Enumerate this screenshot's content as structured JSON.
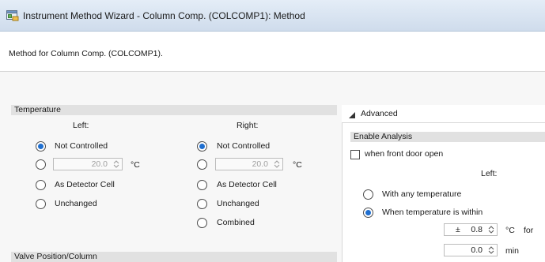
{
  "window": {
    "title": "Instrument Method Wizard - Column Comp. (COLCOMP1): Method",
    "icon": "wizard-icon"
  },
  "header": {
    "text": "Method for Column Comp. (COLCOMP1)."
  },
  "temperature": {
    "section_title": "Temperature",
    "left": {
      "label": "Left:",
      "not_controlled": "Not Controlled",
      "value": "20.0",
      "unit": "°C",
      "as_detector_cell": "As Detector Cell",
      "unchanged": "Unchanged",
      "selected": "Not Controlled"
    },
    "right": {
      "label": "Right:",
      "not_controlled": "Not Controlled",
      "value": "20.0",
      "unit": "°C",
      "as_detector_cell": "As Detector Cell",
      "unchanged": "Unchanged",
      "combined": "Combined",
      "selected": "Not Controlled"
    }
  },
  "valve": {
    "section_title": "Valve Position/Column"
  },
  "advanced": {
    "title": "Advanced",
    "enable_analysis": {
      "section_title": "Enable Analysis",
      "front_door_label": "when front door open",
      "front_door_checked": false,
      "left_label": "Left:",
      "with_any_temperature": "With any temperature",
      "when_within": "When temperature is within",
      "selected": "When temperature is within",
      "tolerance_prefix": "±",
      "tolerance_value": "0.8",
      "tolerance_unit": "°C",
      "for_label": "for",
      "duration_value": "0.0",
      "duration_unit": "min"
    }
  },
  "colors": {
    "radio_selected": "#1f6fd0",
    "section_header_bg": "#e1e1e1",
    "titlebar_bg": "#cfdcec"
  }
}
